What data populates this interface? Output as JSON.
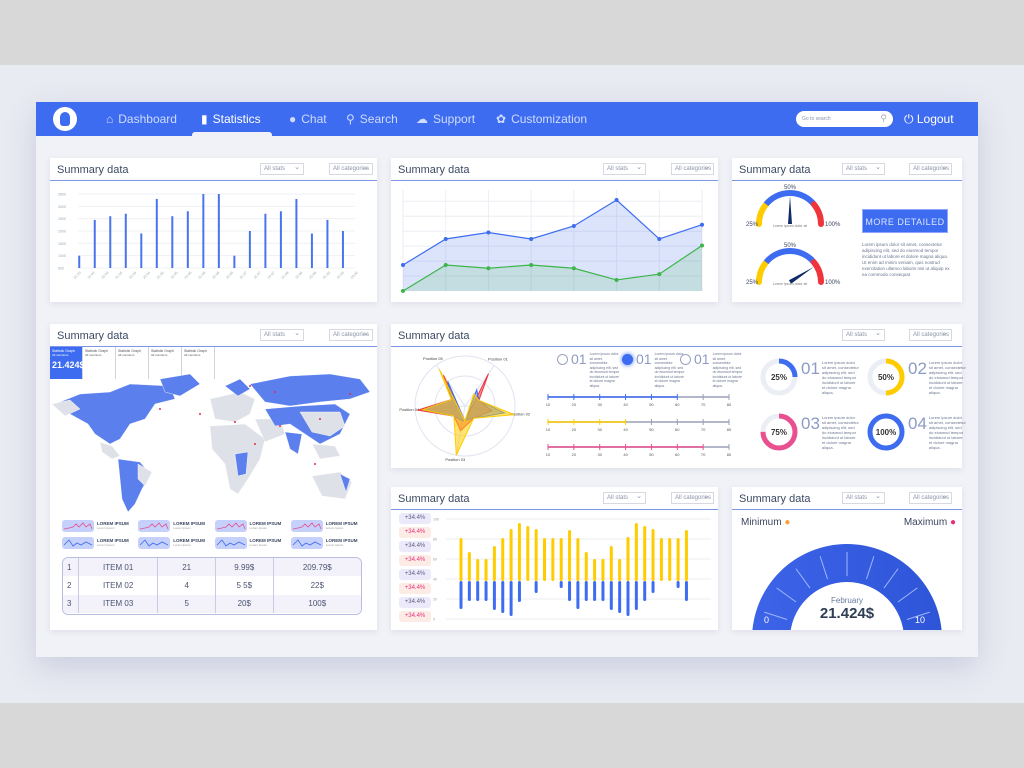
{
  "colors": {
    "accent": "#3d6cf0",
    "yellow": "#ffcc00",
    "red": "#f0343c",
    "pink": "#e8508f",
    "green": "#3db54a",
    "gray": "#9aa3bd"
  },
  "nav": {
    "items": [
      {
        "label": "Dashboard",
        "icon": "home-icon"
      },
      {
        "label": "Statistics",
        "icon": "bar-chart-icon",
        "active": true
      },
      {
        "label": "Chat",
        "icon": "chat-bubble-icon"
      },
      {
        "label": "Search",
        "icon": "search-icon"
      },
      {
        "label": "Support",
        "icon": "support-icon"
      },
      {
        "label": "Customization",
        "icon": "gear-icon"
      }
    ],
    "search_placeholder": "Go to search",
    "logout": "Logout"
  },
  "common": {
    "title": "Summary data",
    "stats": "All stats",
    "categories": "All categories"
  },
  "bar_chart": {
    "type": "bar",
    "y_ticks": [
      "500",
      "1000",
      "1500",
      "2000",
      "2500",
      "3000",
      "3500"
    ],
    "ylim": [
      500,
      3500
    ],
    "categories": [
      "01.03",
      "15.03",
      "20.03",
      "01.04",
      "15.04",
      "20.04",
      "01.05",
      "15.05",
      "20.05",
      "01.06",
      "15.06",
      "20.06",
      "01.07",
      "15.07",
      "20.07",
      "01.08",
      "15.08",
      "20.08",
      "01.09",
      "15.09",
      "20.09"
    ],
    "values": [
      1000,
      2450,
      2600,
      2700,
      1900,
      3300,
      2600,
      2800,
      3500,
      3500,
      1000,
      2000,
      2700,
      2800,
      3300,
      1900,
      2450,
      2000
    ]
  },
  "line_chart": {
    "type": "area",
    "ylim": [
      0,
      8
    ],
    "series": [
      {
        "color": "#3d6cf0",
        "values": [
          2,
          4,
          4.5,
          4,
          5,
          7,
          4,
          5.1
        ]
      },
      {
        "color": "#3db54a",
        "values": [
          0,
          2,
          1.75,
          2,
          1.75,
          0.85,
          1.3,
          3.5
        ]
      }
    ]
  },
  "gauges": {
    "items": [
      {
        "value": 50,
        "caption": "Lorem ipsum dolor sit"
      },
      {
        "value": 82,
        "caption": "Lorem ipsum dolor sit"
      }
    ],
    "labels": {
      "min": "25%",
      "mid": "50%",
      "max": "100%"
    },
    "more_button": "MORE DETAILED",
    "paragraph": "Lorem ipsum dolor sit amet, consectetur adipiscing elit, sed do eiusmod tempor incididunt ut labore et dolore magna aliqua. Ut enim ad minim veniam, quis nostrud exercitation ullamco laboris nisi ut aliquip ex ea commodo consequat"
  },
  "map_panel": {
    "tabs": [
      {
        "title": "Statistic Graph",
        "sub": "All mentions",
        "value": "21.424$",
        "active": true
      },
      {
        "title": "Statistic Graph",
        "sub": "All mentions"
      },
      {
        "title": "Statistic Graph",
        "sub": "All mentions"
      },
      {
        "title": "Statistic Graph",
        "sub": "All mentions"
      },
      {
        "title": "Statistic Graph",
        "sub": "All mentions"
      }
    ],
    "sparklines": {
      "title": "LOREM IPSUM",
      "sub": "Lorem Ipsum"
    },
    "table": [
      [
        "1",
        "ITEM 01",
        "21",
        "9.99$",
        "209.79$"
      ],
      [
        "2",
        "ITEM 02",
        "4",
        "5 5$",
        "22$"
      ],
      [
        "3",
        "ITEM 03",
        "5",
        "20$",
        "100$"
      ]
    ]
  },
  "radar": {
    "axes": [
      "Position 01",
      "Position 02",
      "Position 03",
      "Position 04",
      "Position 05"
    ],
    "series": [
      {
        "color": "#f0343c",
        "values": [
          0.8,
          0.55,
          0.5,
          0.95,
          0.75
        ]
      },
      {
        "color": "#3d6cf0",
        "values": [
          0.4,
          0.8,
          0.3,
          0.85,
          0.6
        ]
      },
      {
        "color": "#ffcc00",
        "values": [
          0.3,
          1.0,
          1.0,
          0.85,
          0.9
        ]
      }
    ]
  },
  "options": [
    {
      "num": "01",
      "selected": false,
      "text": "Lorem ipsum dolor sit amet, consectetur adipiscing elit, sed do eiusmod tempor incididunt ut labore et dolore magna aliqua."
    },
    {
      "num": "01",
      "selected": true,
      "text": "Lorem ipsum dolor sit amet, consectetur adipiscing elit, sed do eiusmod tempor incididunt ut labore et dolore magna aliqua."
    },
    {
      "num": "01",
      "selected": false,
      "text": "Lorem ipsum dolor sit amet, consectetur adipiscing elit, sed do eiusmod tempor incididunt ut labore et dolore magna aliqua."
    }
  ],
  "sliders": {
    "ticks": [
      "10",
      "20",
      "30",
      "40",
      "50",
      "60",
      "70",
      "80"
    ],
    "range": [
      10,
      80
    ],
    "items": [
      {
        "value": 60,
        "color": "#3d6cf0"
      },
      {
        "value": 40,
        "color": "#ffcc00"
      },
      {
        "value": 70,
        "color": "#e8508f"
      }
    ]
  },
  "donuts": [
    {
      "percent": 25,
      "label": "25%",
      "num": "01",
      "color": "#3d6cf0",
      "text": "Lorem ipsum dolor sit amet, consectetur adipiscing elit, sed do eiusmod tempor incididunt ut labore et dolore magna aliqua."
    },
    {
      "percent": 50,
      "label": "50%",
      "num": "02",
      "color": "#ffcc00",
      "text": "Lorem ipsum dolor sit amet, consectetur adipiscing elit, sed do eiusmod tempor incididunt ut labore et dolore magna aliqua."
    },
    {
      "percent": 75,
      "label": "75%",
      "num": "03",
      "color": "#e8508f",
      "text": "Lorem ipsum dolor sit amet, consectetur adipiscing elit, sed do eiusmod tempor incididunt ut labore et dolore magna aliqua."
    },
    {
      "percent": 100,
      "label": "100%",
      "num": "04",
      "color": "#3d6cf0",
      "text": "Lorem ipsum dolor sit amet, consectetur adipiscing elit, sed do eiusmod tempor incididunt ut labore et dolore magna aliqua."
    }
  ],
  "stacked": {
    "type": "bar",
    "y_ticks": [
      "0",
      "20",
      "40",
      "60",
      "80",
      "100"
    ],
    "ylim": [
      0,
      100
    ],
    "baseline": 38,
    "badges": [
      "+34.4%",
      "+34.4%",
      "+34.4%",
      "+34.4%",
      "+34.4%",
      "+34.4%",
      "+34.4%",
      "+34.4%"
    ],
    "yellow_top": [
      81,
      67,
      60,
      60,
      73,
      81,
      90,
      96,
      93,
      90,
      81,
      81,
      81,
      89,
      81,
      67,
      60,
      60,
      73,
      60,
      82,
      96,
      93,
      90,
      81,
      81,
      81,
      89
    ],
    "blue_bottom": [
      10,
      18,
      18,
      18,
      9,
      6,
      3,
      17,
      38,
      26,
      38,
      38,
      31,
      18,
      10,
      18,
      18,
      18,
      9,
      6,
      3,
      9,
      18,
      26,
      38,
      38,
      31,
      18
    ]
  },
  "big_gauge": {
    "min_label": "Minimum",
    "max_label": "Maximum",
    "month": "February",
    "value": "21.424$",
    "scale_min": "0",
    "scale_max": "10"
  }
}
